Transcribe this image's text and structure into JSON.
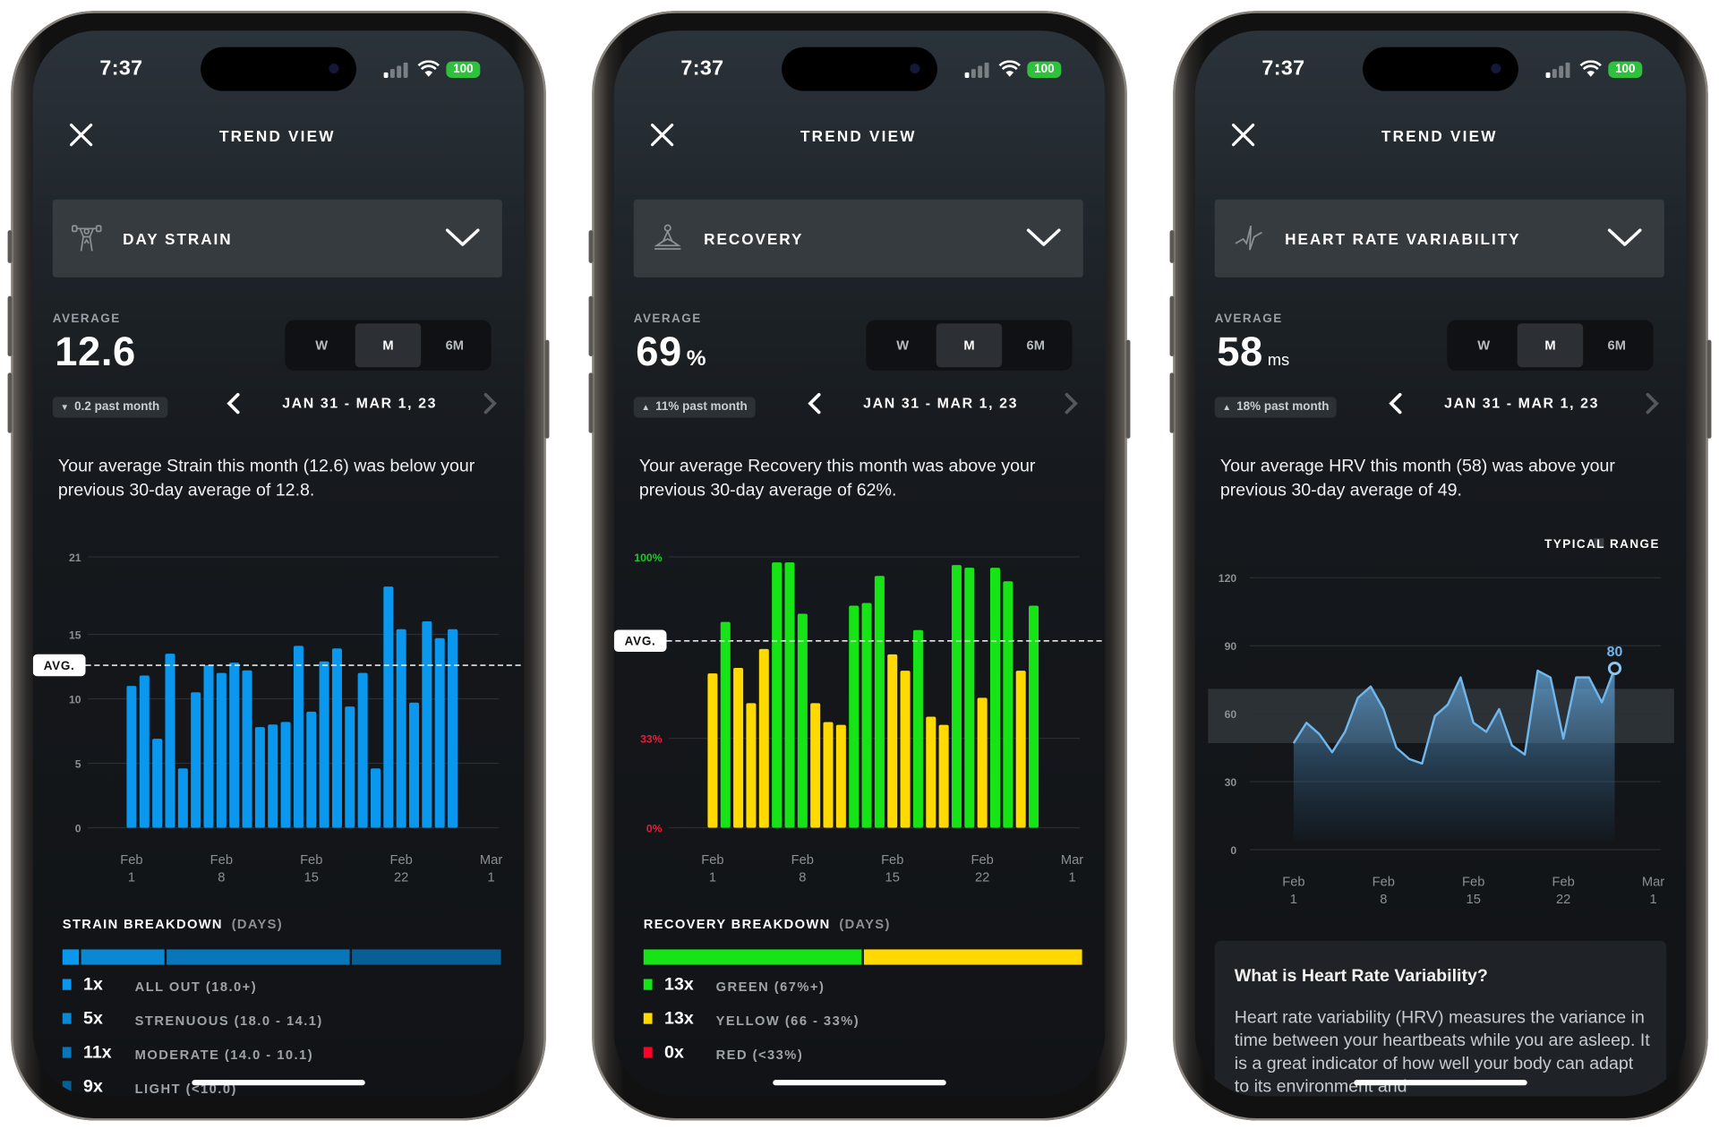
{
  "status_bar": {
    "time": "7:37",
    "battery": "100"
  },
  "screens": [
    {
      "header": {
        "title": "TREND VIEW",
        "close_icon": "close-icon"
      },
      "metric_selector": {
        "label": "DAY STRAIN",
        "icon": "weightlifter-icon"
      },
      "average": {
        "label": "AVERAGE",
        "value": "12.6",
        "unit": ""
      },
      "range_tabs": [
        "W",
        "M",
        "6M"
      ],
      "selected_tab": "M",
      "delta": {
        "direction": "down",
        "text": "0.2 past month"
      },
      "date_range": "JAN 31 - MAR 1, 23",
      "summary": "Your average Strain this month (12.6) was below your previous 30-day average of 12.8.",
      "breakdown": {
        "title": "STRAIN BREAKDOWN",
        "subtitle": "(DAYS)",
        "rows": [
          {
            "count": "1x",
            "label": "ALL OUT (18.0+)",
            "days": 1,
            "color": "#0a98ee"
          },
          {
            "count": "5x",
            "label": "STRENUOUS (18.0 - 14.1)",
            "days": 5,
            "color": "#0a88d4"
          },
          {
            "count": "11x",
            "label": "MODERATE (14.0 - 10.1)",
            "days": 11,
            "color": "#0877b9"
          },
          {
            "count": "9x",
            "label": "LIGHT (<10.0)",
            "days": 9,
            "color": "#075f95"
          }
        ]
      }
    },
    {
      "header": {
        "title": "TREND VIEW",
        "close_icon": "close-icon"
      },
      "metric_selector": {
        "label": "RECOVERY",
        "icon": "meditation-icon"
      },
      "average": {
        "label": "AVERAGE",
        "value": "69",
        "unit": "%"
      },
      "range_tabs": [
        "W",
        "M",
        "6M"
      ],
      "selected_tab": "M",
      "delta": {
        "direction": "up",
        "text": "11% past month"
      },
      "date_range": "JAN 31 - MAR 1, 23",
      "summary": "Your average Recovery this month was above your previous 30-day average of 62%.",
      "breakdown": {
        "title": "RECOVERY BREAKDOWN",
        "subtitle": "(DAYS)",
        "rows": [
          {
            "count": "13x",
            "label": "GREEN (67%+)",
            "days": 13,
            "color": "#16e416"
          },
          {
            "count": "13x",
            "label": "YELLOW (66 - 33%)",
            "days": 13,
            "color": "#ffd900"
          },
          {
            "count": "0x",
            "label": "RED (<33%)",
            "days": 0,
            "color": "#ff0026"
          }
        ]
      }
    },
    {
      "header": {
        "title": "TREND VIEW",
        "close_icon": "close-icon"
      },
      "metric_selector": {
        "label": "HEART RATE VARIABILITY",
        "icon": "hrv-icon"
      },
      "average": {
        "label": "AVERAGE",
        "value": "58",
        "unit": "ms"
      },
      "range_tabs": [
        "W",
        "M",
        "6M"
      ],
      "selected_tab": "M",
      "delta": {
        "direction": "up",
        "text": "18% past month"
      },
      "date_range": "JAN 31 - MAR 1, 23",
      "summary": "Your average HRV this month (58) was above your previous 30-day average of 49.",
      "info_card": {
        "title": "What is Heart Rate Variability?",
        "body": "Heart rate variability (HRV) measures the variance in time between your heartbeats while you are asleep. It is a great indicator of how well your body can adapt to its environment and"
      }
    }
  ],
  "chart_data": [
    {
      "type": "bar",
      "x": [
        "Feb 1",
        "Feb 2",
        "Feb 3",
        "Feb 4",
        "Feb 5",
        "Feb 6",
        "Feb 7",
        "Feb 8",
        "Feb 9",
        "Feb 10",
        "Feb 11",
        "Feb 12",
        "Feb 13",
        "Feb 14",
        "Feb 15",
        "Feb 16",
        "Feb 17",
        "Feb 18",
        "Feb 19",
        "Feb 20",
        "Feb 21",
        "Feb 22",
        "Feb 23",
        "Feb 24",
        "Feb 25",
        "Feb 26"
      ],
      "values": [
        11.0,
        11.8,
        6.9,
        13.5,
        4.6,
        10.5,
        12.6,
        12.0,
        12.8,
        12.2,
        7.8,
        8.0,
        8.2,
        14.1,
        9.0,
        12.9,
        13.9,
        9.4,
        12.0,
        4.6,
        18.7,
        15.4,
        9.7,
        16.0,
        14.7,
        15.4
      ],
      "color": "#0a98ee",
      "ylim": [
        0,
        21
      ],
      "yticks": [
        0,
        5,
        10,
        15,
        21
      ],
      "ytick_labels": [
        "0",
        "5",
        "10",
        "15",
        "21"
      ],
      "xtick_labels": [
        {
          "month": "Feb",
          "day": "1"
        },
        {
          "month": "Feb",
          "day": "8"
        },
        {
          "month": "Feb",
          "day": "15"
        },
        {
          "month": "Feb",
          "day": "22"
        },
        {
          "month": "Mar",
          "day": "1"
        }
      ],
      "average": 12.6,
      "average_label": "AVG.",
      "grid": true
    },
    {
      "type": "bar",
      "x": [
        "Feb 1",
        "Feb 2",
        "Feb 3",
        "Feb 4",
        "Feb 5",
        "Feb 6",
        "Feb 7",
        "Feb 8",
        "Feb 9",
        "Feb 10",
        "Feb 11",
        "Feb 12",
        "Feb 13",
        "Feb 14",
        "Feb 15",
        "Feb 16",
        "Feb 17",
        "Feb 18",
        "Feb 19",
        "Feb 20",
        "Feb 21",
        "Feb 22",
        "Feb 23",
        "Feb 24",
        "Feb 25",
        "Feb 26"
      ],
      "values": [
        57,
        76,
        59,
        46,
        66,
        98,
        98,
        79,
        46,
        39,
        38,
        82,
        83,
        93,
        64,
        58,
        73,
        41,
        38,
        97,
        96,
        48,
        96,
        91,
        58,
        82
      ],
      "categories": [
        "yellow",
        "green",
        "yellow",
        "yellow",
        "yellow",
        "green",
        "green",
        "green",
        "yellow",
        "yellow",
        "yellow",
        "green",
        "green",
        "green",
        "yellow",
        "yellow",
        "green",
        "yellow",
        "yellow",
        "green",
        "green",
        "yellow",
        "green",
        "green",
        "yellow",
        "green"
      ],
      "colors": {
        "green": "#16e416",
        "yellow": "#ffd900",
        "red": "#ff0026"
      },
      "ylim": [
        0,
        100
      ],
      "yticks": [
        0,
        33,
        100
      ],
      "ytick_labels": [
        "0%",
        "33%",
        "100%"
      ],
      "ytick_colors": [
        "#e0203a",
        "#e0203a",
        "#1fc72a"
      ],
      "xtick_labels": [
        {
          "month": "Feb",
          "day": "1"
        },
        {
          "month": "Feb",
          "day": "8"
        },
        {
          "month": "Feb",
          "day": "15"
        },
        {
          "month": "Feb",
          "day": "22"
        },
        {
          "month": "Mar",
          "day": "1"
        }
      ],
      "average": 69,
      "average_label": "AVG.",
      "grid": true
    },
    {
      "type": "area",
      "x": [
        "Feb 1",
        "Feb 2",
        "Feb 3",
        "Feb 4",
        "Feb 5",
        "Feb 6",
        "Feb 7",
        "Feb 8",
        "Feb 9",
        "Feb 10",
        "Feb 11",
        "Feb 12",
        "Feb 13",
        "Feb 14",
        "Feb 15",
        "Feb 16",
        "Feb 17",
        "Feb 18",
        "Feb 19",
        "Feb 20",
        "Feb 21",
        "Feb 22",
        "Feb 23",
        "Feb 24",
        "Feb 25",
        "Feb 26"
      ],
      "values": [
        47,
        56,
        51,
        43,
        52,
        67,
        72,
        62,
        45,
        40,
        38,
        59,
        64,
        76,
        56,
        52,
        62,
        46,
        42,
        79,
        76,
        49,
        76,
        76,
        65,
        80
      ],
      "color": "#6fb6ec",
      "ylim": [
        0,
        120
      ],
      "yticks": [
        0,
        30,
        60,
        90,
        120
      ],
      "ytick_labels": [
        "0",
        "30",
        "60",
        "90",
        "120"
      ],
      "xtick_labels": [
        {
          "month": "Feb",
          "day": "1"
        },
        {
          "month": "Feb",
          "day": "8"
        },
        {
          "month": "Feb",
          "day": "15"
        },
        {
          "month": "Feb",
          "day": "22"
        },
        {
          "month": "Mar",
          "day": "1"
        }
      ],
      "typical_range": [
        47,
        71
      ],
      "legend": "TYPICAL RANGE",
      "legend_position": "top-right",
      "highlight_label": "80",
      "grid": true
    }
  ]
}
